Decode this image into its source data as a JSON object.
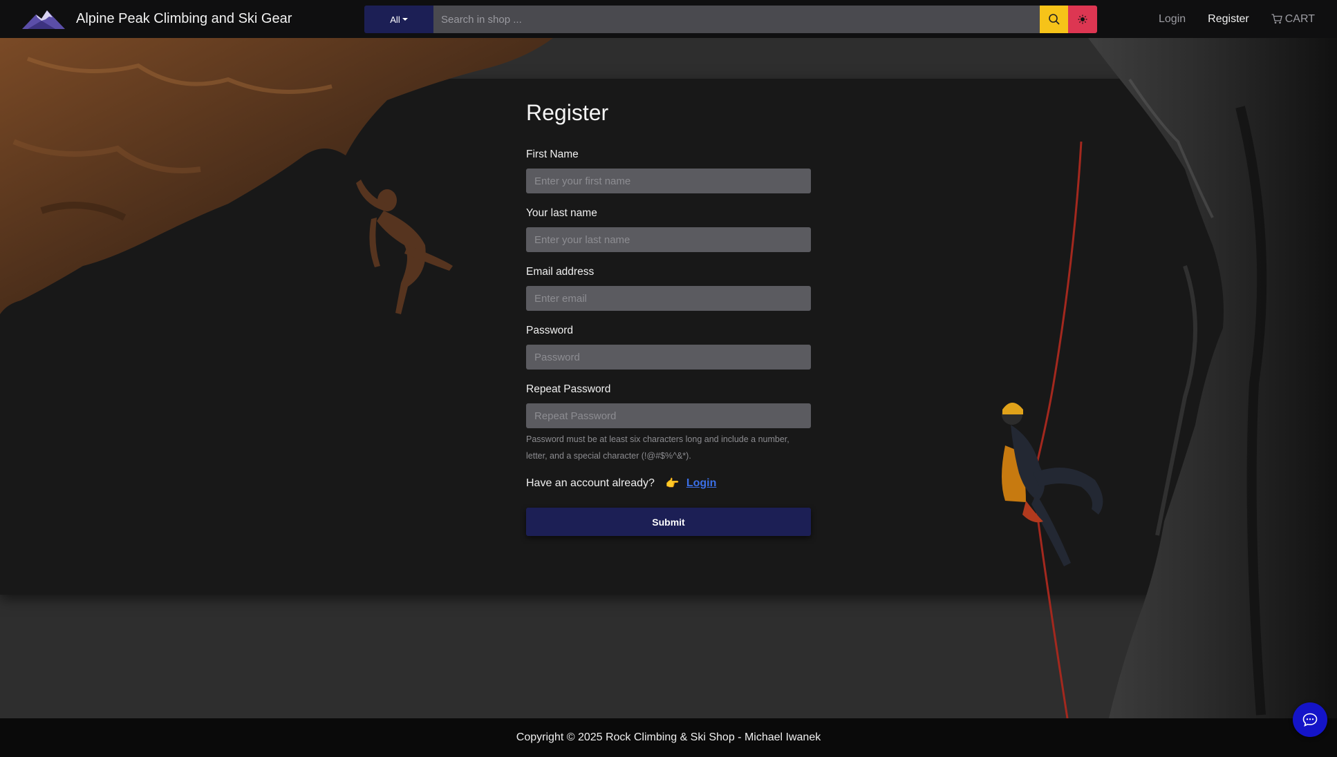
{
  "brand": {
    "title": "Alpine Peak Climbing and Ski Gear",
    "logo_icon": "mountain-logo-icon"
  },
  "search": {
    "category_label": "All",
    "placeholder": "Search in shop ...",
    "search_icon": "search-icon",
    "theme_icon": "sun-icon"
  },
  "nav": {
    "login": "Login",
    "register": "Register",
    "cart": "CART",
    "cart_icon": "cart-icon"
  },
  "form": {
    "title": "Register",
    "first_name_label": "First Name",
    "first_name_placeholder": "Enter your first name",
    "last_name_label": "Your last name",
    "last_name_placeholder": "Enter your last name",
    "email_label": "Email address",
    "email_placeholder": "Enter email",
    "password_label": "Password",
    "password_placeholder": "Password",
    "repeat_label": "Repeat Password",
    "repeat_placeholder": "Repeat Password",
    "help_text": "Password must be at least six characters long and include a number, letter, and a special character (!@#$%^&*).",
    "have_account": "Have an account already?",
    "pointer_emoji": "👉",
    "login_link": "Login",
    "submit": "Submit"
  },
  "footer": {
    "copyright": "Copyright © 2025 Rock Climbing & Ski Shop - Michael Iwanek"
  },
  "chat": {
    "icon": "chat-icon"
  },
  "colors": {
    "navbar_bg": "#0f0f10",
    "primary": "#1c1f55",
    "search_button": "#f6c319",
    "theme_button": "#dd3652",
    "link": "#3b6fe6",
    "chat_button": "#1414c8"
  }
}
